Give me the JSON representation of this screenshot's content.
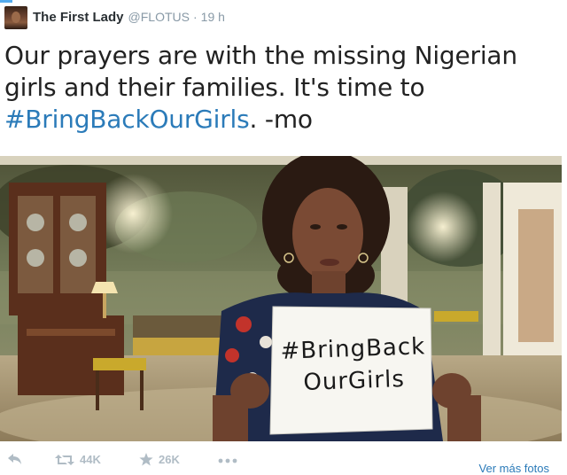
{
  "tweet": {
    "author_name": "The First Lady",
    "author_handle": "@FLOTUS",
    "separator": "·",
    "timestamp": "19 h",
    "text_part1": "Our prayers are with the missing Nigerian girls and their families. It's time to ",
    "hashtag": "#BringBackOurGirls",
    "text_part2": ". -mo"
  },
  "photo": {
    "sign_line1": "#BringBack",
    "sign_line2": "OurGirls"
  },
  "actions": {
    "reply_icon": "reply-icon",
    "retweet_icon": "retweet-icon",
    "retweet_count": "44K",
    "favorite_icon": "star-icon",
    "favorite_count": "26K",
    "more_icon": "more-icon",
    "more_photos_label": "Ver más fotos"
  },
  "colors": {
    "link": "#2b7bb9",
    "meta": "#8899a6",
    "action": "#b0bcc5"
  }
}
